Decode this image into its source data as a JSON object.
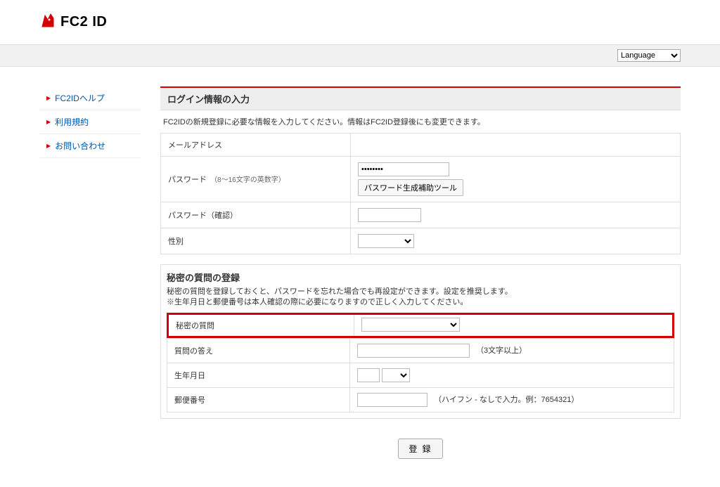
{
  "logo_text": "FC2 ID",
  "topbar": {
    "language_label": "Language"
  },
  "sidebar": {
    "items": [
      {
        "label": "FC2IDヘルプ"
      },
      {
        "label": "利用規約"
      },
      {
        "label": "お問い合わせ"
      }
    ]
  },
  "section_login": {
    "title": "ログイン情報の入力",
    "desc": "FC2IDの新規登録に必要な情報を入力してください。情報はFC2ID登録後にも変更できます。",
    "rows": {
      "email_label": "メールアドレス",
      "password_label": "パスワード",
      "password_hint": "（8～16文字の英数字）",
      "password_tool_btn": "パスワード生成補助ツール",
      "password_confirm_label": "パスワード（確認）",
      "gender_label": "性別"
    }
  },
  "section_secret": {
    "title": "秘密の質問の登録",
    "desc": "秘密の質問を登録しておくと、パスワードを忘れた場合でも再設定ができます。設定を推奨します。",
    "note": "※生年月日と郵便番号は本人確認の際に必要になりますので正しく入力してください。",
    "rows": {
      "question_label": "秘密の質問",
      "answer_label": "質問の答え",
      "answer_hint": "（3文字以上）",
      "birthday_label": "生年月日",
      "zip_label": "郵便番号",
      "zip_hint": "（ハイフン - なしで入力。例：7654321）"
    }
  },
  "submit": {
    "label": "登 録"
  },
  "password_dots": "••••••••"
}
